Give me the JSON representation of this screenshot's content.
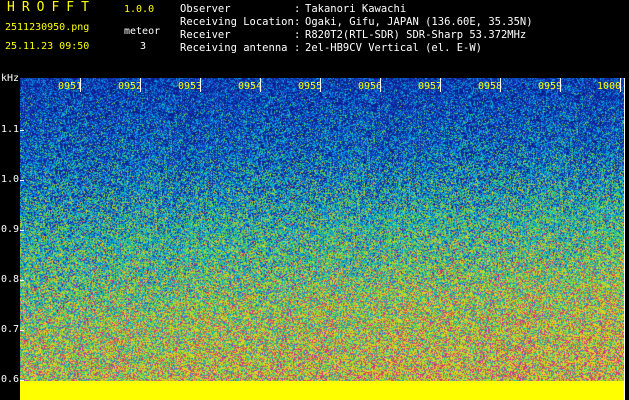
{
  "app": {
    "title": "HROFFT",
    "version": "1.0.0",
    "file_name": "2511230950.png",
    "timestamp": "25.11.23 09:50",
    "meteor_label": "meteor",
    "meteor_count": "3"
  },
  "info": [
    {
      "label": "Observer",
      "value": "Takanori Kawachi"
    },
    {
      "label": "Receiving Location",
      "value": "Ogaki, Gifu, JAPAN (136.60E, 35.35N)"
    },
    {
      "label": "Receiver",
      "value": "R820T2(RTL-SDR) SDR-Sharp 53.372MHz"
    },
    {
      "label": "Receiving antenna",
      "value": "2el-HB9CV Vertical (el. E-W)"
    }
  ],
  "separator": ":",
  "axis": {
    "unit_label": "kHz",
    "y_ticks": [
      "1.1",
      "1.0",
      "0.9",
      "0.8",
      "0.7",
      "0.6"
    ],
    "time_labels": [
      "0951",
      "0952",
      "0953",
      "0954",
      "0955",
      "0956",
      "0957",
      "0958",
      "0959",
      "1000"
    ]
  },
  "colors": {
    "background": "#000000",
    "accent_yellow": "#ffff00",
    "spectro_base": "#0a2a8a"
  }
}
